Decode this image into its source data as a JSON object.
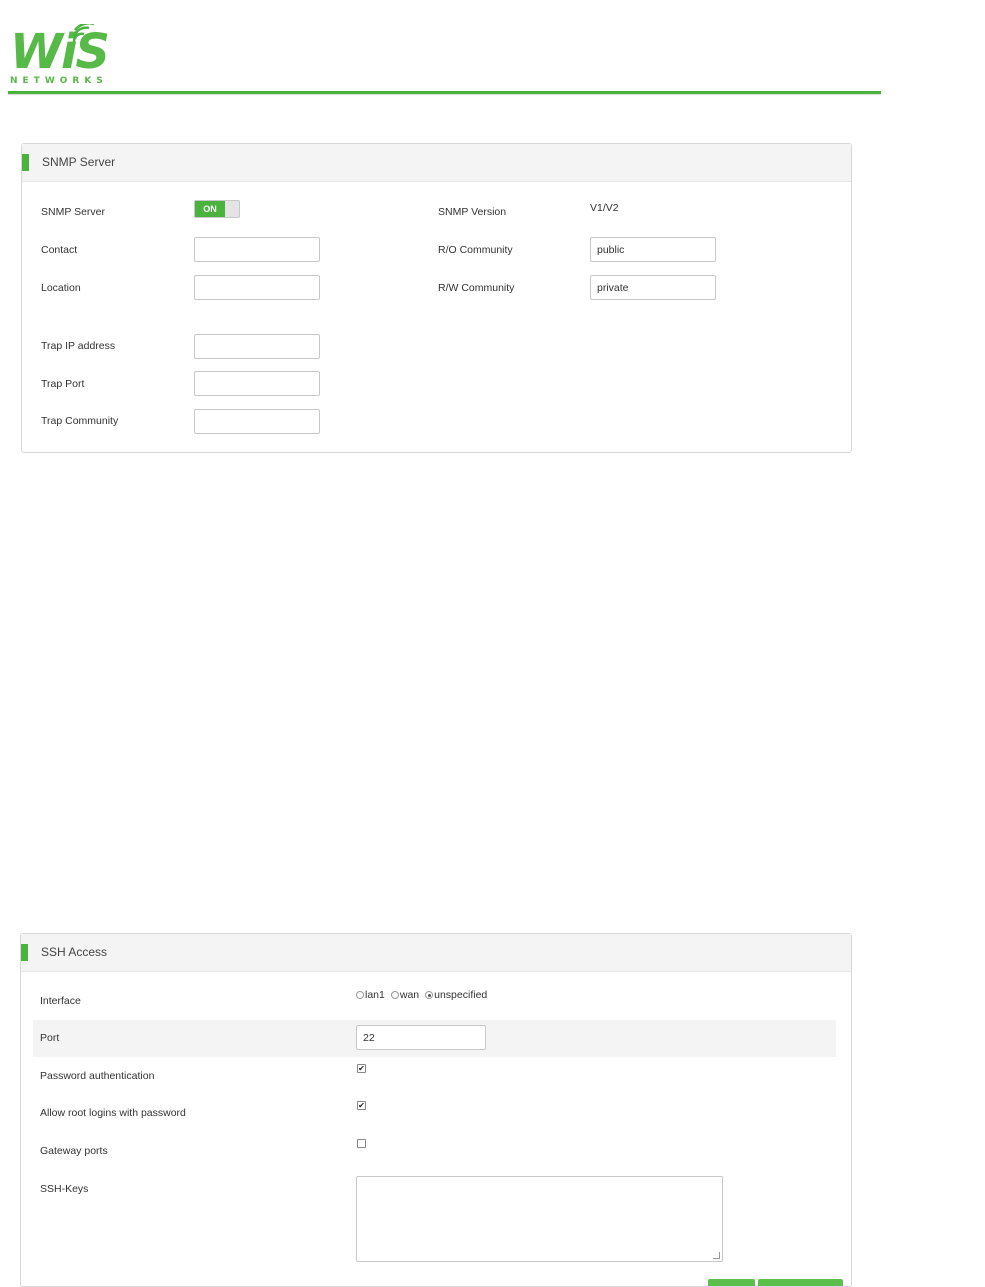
{
  "brand": {
    "logo_text": "WiS",
    "logo_sub": "NETWORKS",
    "accent_color": "#4ab33e"
  },
  "snmp": {
    "title": "SNMP Server",
    "server_label": "SNMP Server",
    "server_toggle": "ON",
    "version_label": "SNMP Version",
    "version_value": "V1/V2",
    "contact_label": "Contact",
    "contact_value": "",
    "ro_label": "R/O Community",
    "ro_value": "public",
    "location_label": "Location",
    "location_value": "",
    "rw_label": "R/W Community",
    "rw_value": "private",
    "trap_ip_label": "Trap IP address",
    "trap_ip_value": "",
    "trap_port_label": "Trap Port",
    "trap_port_value": "",
    "trap_community_label": "Trap Community",
    "trap_community_value": ""
  },
  "ssh": {
    "title": "SSH Access",
    "interface_label": "Interface",
    "interface_options": [
      "lan1",
      "wan",
      "unspecified"
    ],
    "interface_selected": "unspecified",
    "port_label": "Port",
    "port_value": "22",
    "password_auth_label": "Password authentication",
    "password_auth_checked": true,
    "root_login_label": "Allow root logins with password",
    "root_login_checked": true,
    "gateway_ports_label": "Gateway ports",
    "gateway_ports_checked": false,
    "ssh_keys_label": "SSH-Keys",
    "ssh_keys_value": ""
  }
}
